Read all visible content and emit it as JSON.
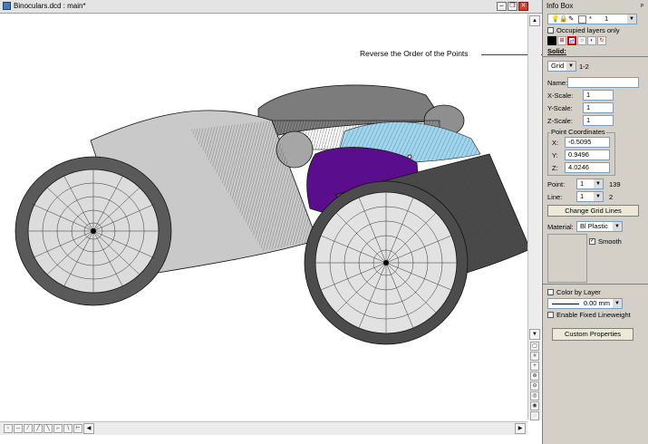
{
  "window": {
    "title": "Binoculars.dcd : main*"
  },
  "callout": {
    "text": "Reverse the Order of the Points"
  },
  "panel": {
    "title": "Info Box",
    "layer_value": "1",
    "occupied_layers_label": "Occupied layers only",
    "solid_label": "Solid:",
    "object_type": "Grid",
    "object_range": "1-2",
    "name_label": "Name:",
    "name_value": "",
    "x_scale_label": "X-Scale:",
    "x_scale_value": "1",
    "y_scale_label": "Y-Scale:",
    "y_scale_value": "1",
    "z_scale_label": "Z-Scale:",
    "z_scale_value": "1",
    "point_coords_title": "Point Coordinates",
    "x_label": "X:",
    "x_value": "-0.5095",
    "y_label": "Y:",
    "y_value": "0.9496",
    "z_label": "Z:",
    "z_value": "4.0246",
    "point_label": "Point:",
    "point_value": "1",
    "point_total": "139",
    "line_label": "Line:",
    "line_value": "1",
    "line_total": "2",
    "change_grid_lines": "Change Grid Lines",
    "material_label": "Material:",
    "material_value": "Bl Plastic",
    "smooth_label": "Smooth",
    "color_by_layer_label": "Color by Layer",
    "lineweight_value": "0.00 mm",
    "enable_fixed_lineweight_label": "Enable Fixed Lineweight",
    "custom_properties": "Custom Properties"
  }
}
